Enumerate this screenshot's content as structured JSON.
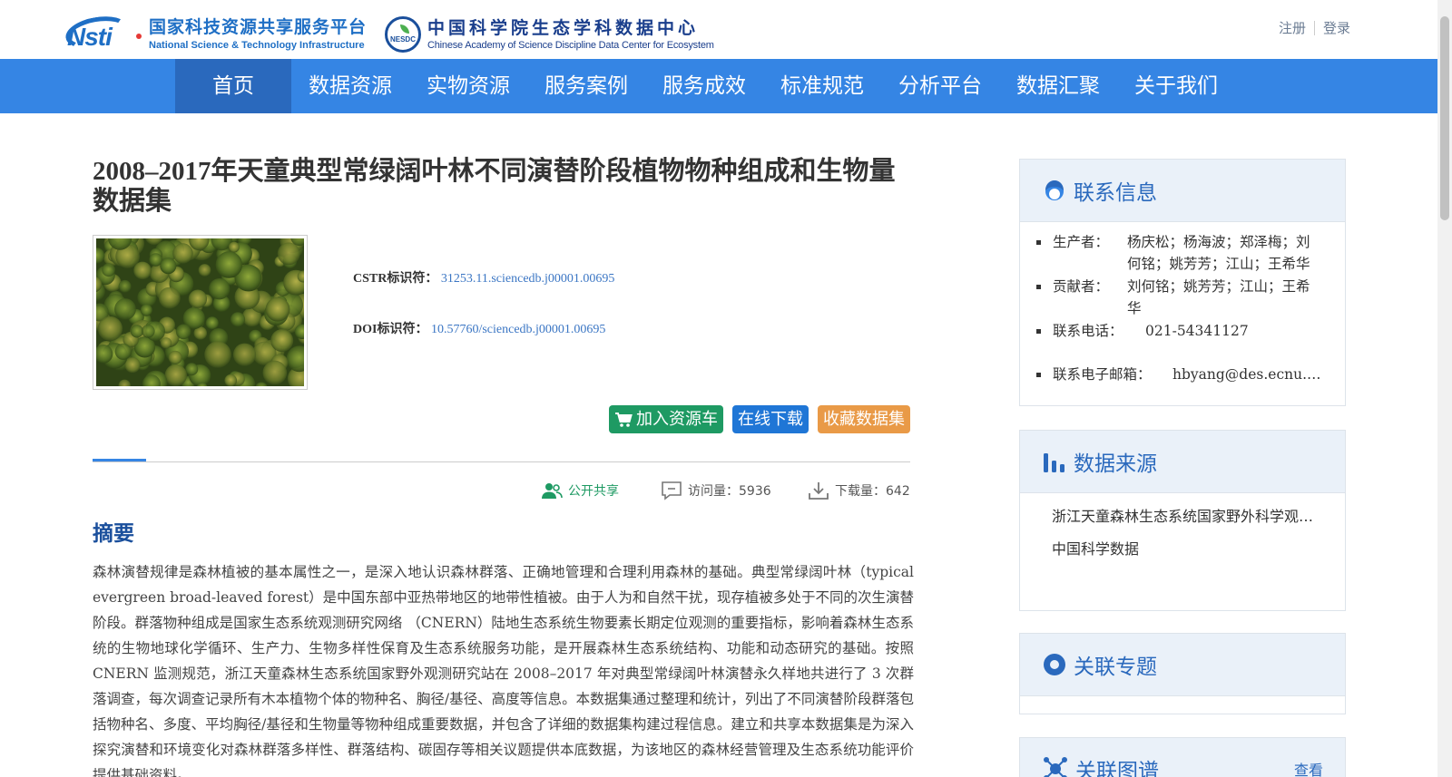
{
  "header": {
    "nsti_mark": "Nsti",
    "nsti_cn": "国家科技资源共享服务平台",
    "nsti_en": "National Science & Technology Infrastructure",
    "nesdc_mark": "NESDC",
    "nesdc_cn": "中国科学院生态学科数据中心",
    "nesdc_en": "Chinese Academy of Science Discipline Data Center for Ecosystem",
    "register": "注册",
    "login": "登录"
  },
  "nav": {
    "items": [
      "首页",
      "数据资源",
      "实物资源",
      "服务案例",
      "服务成效",
      "标准规范",
      "分析平台",
      "数据汇聚",
      "关于我们"
    ],
    "active": 0
  },
  "dataset": {
    "title": "2008–2017年天童典型常绿阔叶林不同演替阶段植物物种组成和生物量数据集",
    "cstr_label": "CSTR标识符：",
    "cstr_value": "31253.11.sciencedb.j00001.00695",
    "doi_label": "DOI标识符：",
    "doi_value": "10.57760/sciencedb.j00001.00695"
  },
  "actions": {
    "cart": "加入资源车",
    "download": "在线下载",
    "favorite": "收藏数据集"
  },
  "stats": {
    "share": "公开共享",
    "visits": "访问量：5936",
    "downloads": "下载量：642"
  },
  "abstract": {
    "heading": "摘要",
    "text": "森林演替规律是森林植被的基本属性之一，是深入地认识森林群落、正确地管理和合理利用森林的基础。典型常绿阔叶林（typical evergreen broad-leaved forest）是中国东部中亚热带地区的地带性植被。由于人为和自然干扰，现存植被多处于不同的次生演替阶段。群落物种组成是国家生态系统观测研究网络 （CNERN）陆地生态系统生物要素长期定位观测的重要指标，影响着森林生态系统的生物地球化学循环、生产力、生物多样性保育及生态系统服务功能，是开展森林生态系统结构、功能和动态研究的基础。按照 CNERN 监测规范，浙江天童森林生态系统国家野外观测研究站在 2008–2017 年对典型常绿阔叶林演替永久样地共进行了 3 次群落调查，每次调查记录所有木本植物个体的物种名、胸径/基径、高度等信息。本数据集通过整理和统计，列出了不同演替阶段群落包括物种名、多度、平均胸径/基径和生物量等物种组成重要数据，并包含了详细的数据集构建过程信息。建立和共享本数据集是为深入探究演替和环境变化对森林群落多样性、群落结构、碳固存等相关议题提供本底数据，为该地区的森林经营管理及生态系统功能评价提供基础资料。"
  },
  "sidebar": {
    "contact": {
      "title": "联系信息",
      "producer_label": "生产者：",
      "producer_value": "杨庆松；杨海波；郑泽梅；刘何铭；姚芳芳；江山；王希华",
      "contributor_label": "贡献者：",
      "contributor_value": "刘何铭；姚芳芳；江山；王希华",
      "phone_label": "联系电话：",
      "phone_value": "021-54341127",
      "email_label": "联系电子邮箱：",
      "email_value": "hbyang@des.ecnu.edu.cn"
    },
    "source": {
      "title": "数据来源",
      "items": [
        "浙江天童森林生态系统国家野外科学观测研究站",
        "中国科学数据"
      ]
    },
    "topic": {
      "title": "关联专题"
    },
    "graph": {
      "title": "关联图谱",
      "more": "查看"
    }
  },
  "colors": {
    "nav_bg": "#3585e4",
    "nav_active": "#2a69bd",
    "cart_btn": "#1e9a63",
    "download_btn": "#1f76d6",
    "favorite_btn": "#e99a47",
    "panel_head": "#eaf1f9",
    "link": "#3b76c4"
  }
}
